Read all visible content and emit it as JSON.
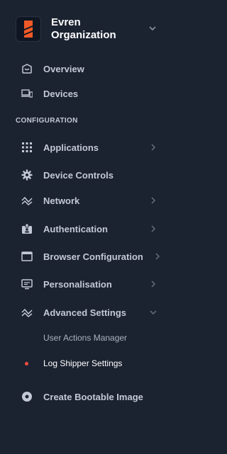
{
  "org": {
    "name": "Evren Organization",
    "logo": "evren-logo-icon"
  },
  "nav_top": [
    {
      "label": "Overview",
      "icon": "overview-icon"
    },
    {
      "label": "Devices",
      "icon": "devices-icon"
    }
  ],
  "section_label": "CONFIGURATION",
  "nav_config": [
    {
      "label": "Applications",
      "icon": "grid-icon",
      "chevron": "right"
    },
    {
      "label": "Device Controls",
      "icon": "gear-icon"
    },
    {
      "label": "Network",
      "icon": "network-icon",
      "chevron": "right"
    },
    {
      "label": "Authentication",
      "icon": "id-badge-icon",
      "chevron": "right"
    },
    {
      "label": "Browser Configuration",
      "icon": "browser-window-icon",
      "chevron": "right"
    },
    {
      "label": "Personalisation",
      "icon": "monitor-icon",
      "chevron": "right"
    },
    {
      "label": "Advanced Settings",
      "icon": "advanced-icon",
      "chevron": "down",
      "expanded": true
    }
  ],
  "sub_items": [
    {
      "label": "User Actions Manager",
      "active": false
    },
    {
      "label": "Log Shipper Settings",
      "active": true
    }
  ],
  "nav_bottom": [
    {
      "label": "Create Bootable Image",
      "icon": "disc-icon"
    }
  ],
  "colors": {
    "background": "#1b2230",
    "text": "#c3c9d4",
    "active_text": "#ffffff",
    "accent": "#ff4d3d",
    "logo_orange": "#f05a28"
  }
}
